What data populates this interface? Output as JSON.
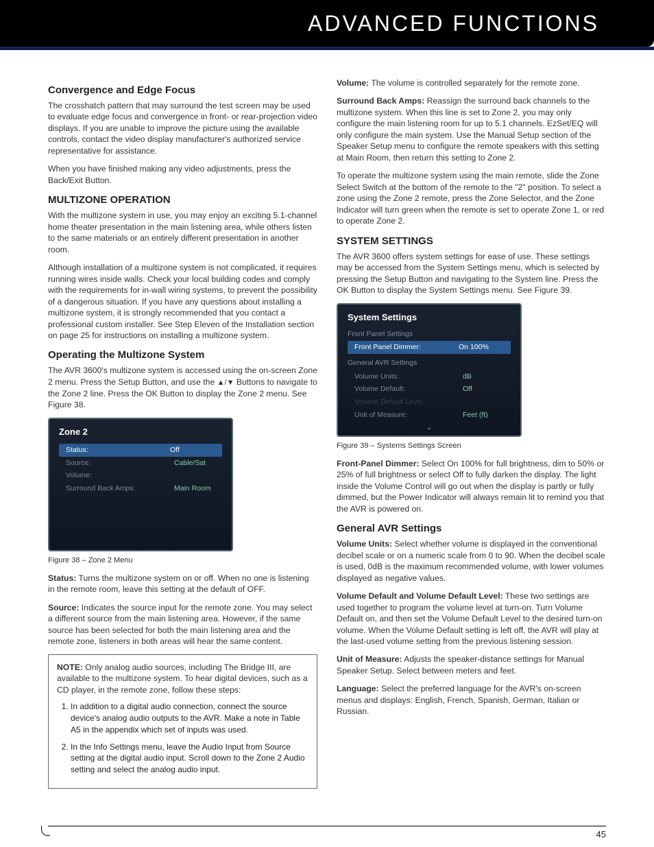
{
  "header": {
    "title": "ADVANCED FUNCTIONS"
  },
  "page_number": "45",
  "col1": {
    "h_conv": "Convergence and Edge Focus",
    "p_conv1": "The crosshatch pattern that may surround the test screen may be used to evaluate edge focus and convergence in front- or rear-projection video displays. If you are unable to improve the picture using the available controls, contact the video display manufacturer's authorized service representative for assistance.",
    "p_conv2": "When you have finished making any video adjustments, press the Back/Exit Button.",
    "h_multi": "MULTIZONE OPERATION",
    "p_multi1": "With the multizone system in use, you may enjoy an exciting 5.1-channel home theater presentation in the main listening area, while others listen to the same materials or an entirely different presentation in another room.",
    "p_multi2": "Although installation of a multizone system is not complicated, it requires running wires inside walls. Check your local building codes and comply with the requirements for in-wall wiring systems, to prevent the possibility of a dangerous situation. If you have any questions about installing a multizone system, it is strongly recommended that you contact a professional custom installer. See Step Eleven of the Installation section on page 25 for instructions on installing a multizone system.",
    "h_op": "Operating the Multizone System",
    "p_op_a": "The AVR 3600's multizone system is accessed using the on-screen Zone 2 menu. Press the Setup Button, and use the ",
    "p_op_arrows": "▲/▼",
    "p_op_b": " Buttons to navigate to the Zone 2 line. Press the OK Button to display the Zone 2 menu. See Figure 38.",
    "fig38": {
      "title": "Zone 2",
      "rows": [
        {
          "label": "Status:",
          "val": "Off",
          "hl": true
        },
        {
          "label": "Source:",
          "val": "Cable/Sat"
        },
        {
          "label": "Volume:",
          "val": ""
        },
        {
          "label": "Surround Back Amps:",
          "val": "Main Room"
        }
      ],
      "caption": "Figure 38 – Zone 2 Menu"
    },
    "status_b": "Status:",
    "status_t": " Turns the multizone system on or off. When no one is listening in the remote room, leave this setting at the default of OFF.",
    "source_b": "Source:",
    "source_t": " Indicates the source input for the remote zone. You may select a different source from the main listening area. However, if the same source has been selected for both the main listening area and the remote zone, listeners in both areas will hear the same content.",
    "note": {
      "lead_b": "NOTE:",
      "lead_t": " Only analog audio sources, including The Bridge III, are available to the multizone system. To hear digital devices, such as a CD player, in the remote zone, follow these steps:",
      "li1": "In addition to a digital audio connection, connect the source device's analog audio outputs to the AVR. Make a note in Table A5 in the appendix which set of inputs was used.",
      "li2": "In the Info Settings menu, leave the Audio Input from Source setting at the digital audio input. Scroll down to the Zone 2 Audio setting and select the analog audio input."
    }
  },
  "col2": {
    "vol_b": "Volume:",
    "vol_t": " The volume is controlled separately for the remote zone.",
    "sba_b": "Surround Back Amps:",
    "sba_t": " Reassign the surround back channels to the multizone system. When this line is set to Zone 2, you may only configure the main listening room for up to 5.1 channels. EzSet/EQ will only configure the main system. Use the Manual Setup section of the Speaker Setup menu to configure the remote speakers with this setting at Main Room, then return this setting to Zone 2.",
    "p_op2": "To operate the multizone system using the main remote, slide the Zone Select Switch at the bottom of the remote to the \"2\" position. To select a zone using the Zone 2 remote, press the Zone Selector, and the Zone Indicator will turn green when the remote is set to operate Zone 1, or red to operate Zone 2.",
    "h_sys": "SYSTEM SETTINGS",
    "p_sys1": "The AVR 3600 offers system settings for ease of use. These settings may be accessed from the System Settings menu, which is selected by pressing the Setup Button and navigating to the System line. Press the OK Button to display the System Settings menu. See Figure 39.",
    "fig39": {
      "title": "System Settings",
      "sub1": "Front Panel Settings",
      "row1": {
        "label": "Front Panel Dimmer:",
        "val": "On 100%"
      },
      "sub2": "General AVR Settings",
      "rows2": [
        {
          "label": "Volume Units:",
          "val": "dB"
        },
        {
          "label": "Volume Default:",
          "val": "Off"
        },
        {
          "label": "Volume Default Level:",
          "val": ""
        },
        {
          "label": "Unit of Measure:",
          "val": "Feet (ft)"
        }
      ],
      "caption": "Figure 39 – Systems Settings Screen"
    },
    "fpd_b": "Front-Panel Dimmer:",
    "fpd_t": " Select On 100% for full brightness, dim to 50% or 25% of full brightness or select Off to fully darken the display. The light inside the Volume Control will go out when the display is partly or fully dimmed, but the Power Indicator will always remain lit to remind you that the AVR is powered on.",
    "h_gen": "General AVR Settings",
    "vu_b": "Volume Units:",
    "vu_t": " Select whether volume is displayed in the conventional decibel scale or on a numeric scale from 0 to 90. When the decibel scale is used, 0dB is the maximum recommended volume, with lower volumes displayed as negative values.",
    "vdl_b": "Volume Default and Volume Default Level:",
    "vdl_t": " These two settings are used together to program the volume level at turn-on. Turn Volume Default on, and then set the Volume Default Level to the desired turn-on volume. When the Volume Default setting is left off, the AVR will play at the last-used volume setting from the previous listening session.",
    "uom_b": "Unit of Measure:",
    "uom_t": " Adjusts the speaker-distance settings for Manual Speaker Setup. Select between meters and feet.",
    "lang_b": "Language:",
    "lang_t": " Select the preferred language for the AVR's on-screen menus and displays: English, French, Spanish, German, Italian or Russian."
  }
}
